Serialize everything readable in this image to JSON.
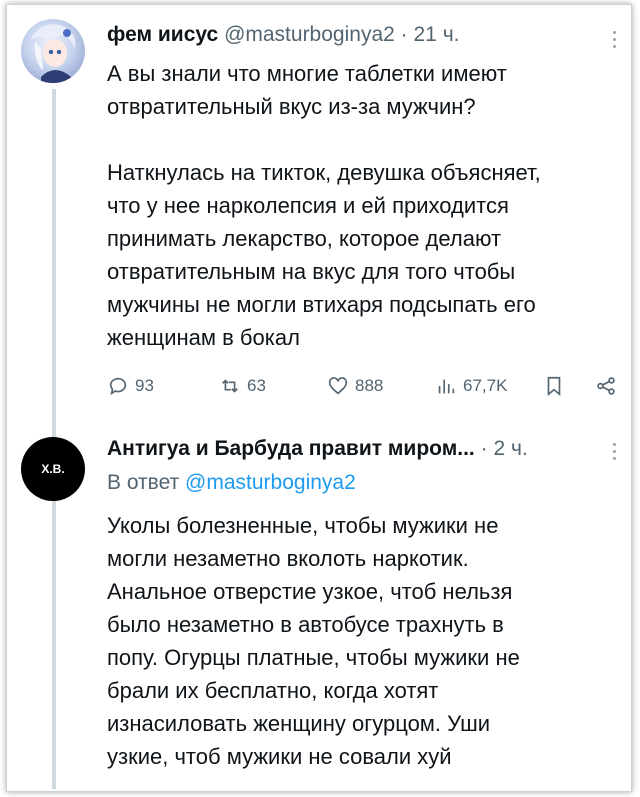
{
  "tweet1": {
    "author_name": "фем иисус",
    "handle": "@masturboginya2",
    "separator": "·",
    "time": "21 ч.",
    "text": "А вы знали что многие таблетки имеют\nотвратительный вкус из-за мужчин?\n\nНаткнулась на тикток, девушка объясняет,\nчто у нее нарколепсия и ей приходится\nпринимать лекарство, которое делают\nотвратительным на вкус для того чтобы\nмужчины не могли втихаря подсыпать его\nженщинам в бокал",
    "actions": {
      "replies": "93",
      "retweets": "63",
      "likes": "888",
      "views": "67,7K"
    }
  },
  "tweet2": {
    "avatar_text": "Х.В.",
    "author_name": "Антигуа и Барбуда правит миром...",
    "separator": "·",
    "time": "2 ч.",
    "reply_prefix": "В ответ",
    "reply_handle": "@masturboginya2",
    "text": "Уколы болезненные, чтобы мужики не\nмогли незаметно вколоть наркотик.\nАнальное отверстие узкое, чтоб нельзя\nбыло незаметно в автобусе трахнуть в\nпопу. Огурцы платные, чтобы мужики не\nбрали их бесплатно, когда хотят\nизнасиловать женщину огурцом. Уши\nузкие, чтоб мужики не совали хуй"
  },
  "colors": {
    "text": "#0f1419",
    "secondary": "#536471",
    "link": "#1d9bf0",
    "thread_line": "#cfd9de"
  },
  "icons": [
    "reply-icon",
    "retweet-icon",
    "like-icon",
    "views-icon",
    "bookmark-icon",
    "share-icon",
    "more-icon"
  ]
}
